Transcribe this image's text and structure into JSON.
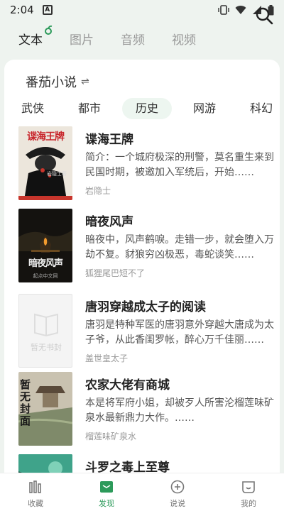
{
  "status": {
    "time": "2:04",
    "notif_glyph": "A"
  },
  "top_tabs": [
    {
      "label": "文本",
      "active": true
    },
    {
      "label": "图片",
      "active": false
    },
    {
      "label": "音频",
      "active": false
    },
    {
      "label": "视频",
      "active": false
    }
  ],
  "source": {
    "label": "番茄小说",
    "swap_glyph": "⇌"
  },
  "categories": [
    "武侠",
    "都市",
    "历史",
    "网游",
    "科幻"
  ],
  "active_category": "历史",
  "books": [
    {
      "title": "谍海王牌",
      "desc": "简介：一个城府极深的刑警，莫名重生来到民国时期，被邀加入军统后，开始……",
      "author": "岩隐士",
      "cover_text": "谍海王牌",
      "cover_sub": "岩隐士著"
    },
    {
      "title": "暗夜风声",
      "desc": "暗夜中，风声鹤唳。走错一步，就会堕入万劫不复。豺狼穷凶极恶，毒蛇谈笑……",
      "author": "狐狸尾巴短不了",
      "cover_text": "暗夜风声",
      "cover_sub": "起点中文网"
    },
    {
      "title": "唐羽穿越成太子的阅读",
      "desc": "唐羽是特种军医的唐羽意外穿越大唐成为太子爷，从此香闺罗帐，醉心万千佳丽……",
      "author": "盖世皇太子",
      "cover_text": "暂无书封",
      "cover_sub": ""
    },
    {
      "title": "农家大佬有商城",
      "desc": "本是将军府小姐，却被歹人所害沦榴莲味矿泉水最新鼎力大作。……",
      "author": "榴莲味矿泉水",
      "cover_text": "暂无封面",
      "cover_sub": ""
    },
    {
      "title": "斗罗之毒上至尊",
      "desc": "",
      "author": "",
      "cover_text": "",
      "cover_sub": ""
    }
  ],
  "bottom_nav": [
    {
      "label": "收藏",
      "icon": "bookshelf-icon",
      "active": false
    },
    {
      "label": "发现",
      "icon": "book-open-icon",
      "active": true
    },
    {
      "label": "说说",
      "icon": "plus-circle-icon",
      "active": false
    },
    {
      "label": "我的",
      "icon": "smile-icon",
      "active": false
    }
  ],
  "colors": {
    "accent": "#2c9a5a",
    "background": "#eef3ef"
  }
}
